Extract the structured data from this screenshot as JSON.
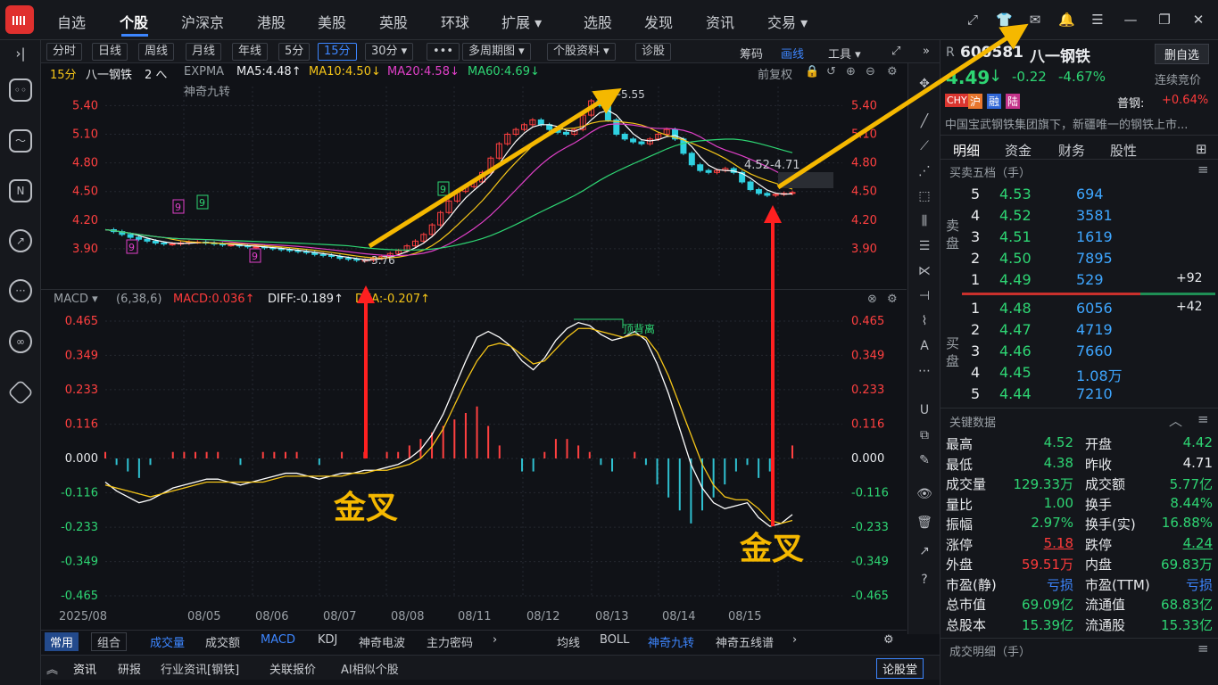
{
  "topnav": {
    "items": [
      "自选",
      "个股",
      "沪深京",
      "港股",
      "美股",
      "英股",
      "环球",
      "扩展 ▾",
      "选股",
      "发现",
      "资讯",
      "交易 ▾"
    ]
  },
  "toolbar": {
    "buttons": [
      "分时",
      "日线",
      "周线",
      "月线",
      "年线",
      "5分",
      "15分",
      "30分 ▾",
      "•••",
      "多周期图 ▾",
      "个股资料 ▾",
      "诊股"
    ],
    "right": [
      "筹码",
      "画线",
      "工具 ▾"
    ]
  },
  "chart_header": {
    "period": "15分",
    "name": "八一钢铁",
    "count": "2 へ",
    "expma": "EXPMA",
    "ma5": "MA5:4.48↑",
    "ma10": "MA10:4.50↓",
    "ma20": "MA20:4.58↓",
    "ma60": "MA60:4.69↓",
    "indicator": "神奇九转",
    "adjust": "前复权"
  },
  "chart_data": [
    {
      "type": "candlestick",
      "title": "15分 八一钢铁",
      "y_ticks": [
        "5.40",
        "5.10",
        "4.80",
        "4.50",
        "4.20",
        "3.90"
      ],
      "ylim": [
        3.6,
        5.6
      ],
      "x_labels": [
        "2025/08",
        "08/05",
        "08/06",
        "08/07",
        "08/08",
        "08/11",
        "08/12",
        "08/13",
        "08/14",
        "08/15"
      ],
      "ma_lines": {
        "MA5": 4.48,
        "MA10": 4.5,
        "MA20": 4.58,
        "MA60": 4.69
      },
      "annotations": [
        "5.55",
        "3.76",
        "4.52-4.71"
      ],
      "close": [
        4.1,
        4.08,
        4.05,
        4.02,
        4.0,
        3.98,
        3.96,
        3.95,
        3.95,
        3.96,
        3.97,
        3.97,
        3.96,
        3.95,
        3.94,
        3.94,
        3.93,
        3.92,
        3.92,
        3.91,
        3.9,
        3.89,
        3.88,
        3.87,
        3.86,
        3.84,
        3.83,
        3.82,
        3.8,
        3.79,
        3.78,
        3.78,
        3.8,
        3.82,
        3.85,
        3.88,
        3.93,
        3.98,
        4.05,
        4.15,
        4.28,
        4.4,
        4.5,
        4.55,
        4.6,
        4.7,
        4.85,
        5.0,
        5.1,
        5.15,
        5.2,
        5.25,
        5.2,
        5.15,
        5.12,
        5.1,
        5.15,
        5.3,
        5.45,
        5.4,
        5.25,
        5.1,
        5.05,
        5.02,
        5.0,
        5.05,
        5.1,
        5.15,
        5.05,
        4.9,
        4.78,
        4.72,
        4.7,
        4.72,
        4.74,
        4.7,
        4.6,
        4.52,
        4.48,
        4.46,
        4.47,
        4.48,
        4.49
      ]
    },
    {
      "type": "line",
      "title": "MACD (6,38,6)",
      "y_ticks": [
        "0.465",
        "0.349",
        "0.233",
        "0.116",
        "0.000",
        "-0.116",
        "-0.233",
        "-0.349",
        "-0.465"
      ],
      "ylim": [
        -0.465,
        0.465
      ],
      "series": [
        {
          "name": "DIFF",
          "value": -0.189
        },
        {
          "name": "DEA",
          "value": -0.207
        },
        {
          "name": "MACD",
          "value": 0.036
        }
      ],
      "diff": [
        -0.08,
        -0.11,
        -0.13,
        -0.15,
        -0.14,
        -0.12,
        -0.1,
        -0.09,
        -0.08,
        -0.07,
        -0.07,
        -0.08,
        -0.09,
        -0.08,
        -0.07,
        -0.06,
        -0.05,
        -0.05,
        -0.06,
        -0.07,
        -0.06,
        -0.05,
        -0.05,
        -0.04,
        -0.04,
        -0.03,
        -0.02,
        0.0,
        0.03,
        0.08,
        0.15,
        0.24,
        0.33,
        0.41,
        0.43,
        0.41,
        0.38,
        0.33,
        0.3,
        0.34,
        0.4,
        0.44,
        0.46,
        0.45,
        0.42,
        0.4,
        0.41,
        0.43,
        0.4,
        0.32,
        0.22,
        0.1,
        -0.02,
        -0.1,
        -0.15,
        -0.17,
        -0.16,
        -0.15,
        -0.2,
        -0.23,
        -0.22,
        -0.19
      ],
      "dea": [
        -0.09,
        -0.1,
        -0.11,
        -0.12,
        -0.13,
        -0.12,
        -0.11,
        -0.1,
        -0.09,
        -0.08,
        -0.08,
        -0.08,
        -0.08,
        -0.08,
        -0.08,
        -0.07,
        -0.06,
        -0.06,
        -0.06,
        -0.06,
        -0.06,
        -0.06,
        -0.05,
        -0.05,
        -0.04,
        -0.04,
        -0.03,
        -0.02,
        0.0,
        0.04,
        0.1,
        0.18,
        0.26,
        0.33,
        0.38,
        0.39,
        0.38,
        0.35,
        0.32,
        0.33,
        0.37,
        0.41,
        0.44,
        0.44,
        0.43,
        0.42,
        0.41,
        0.42,
        0.41,
        0.36,
        0.28,
        0.18,
        0.08,
        -0.02,
        -0.09,
        -0.13,
        -0.14,
        -0.14,
        -0.17,
        -0.21,
        -0.22,
        -0.21
      ],
      "annotations": [
        "顶背离",
        "金叉",
        "金叉"
      ]
    }
  ],
  "macd_header": {
    "name": "MACD ▾",
    "params": "(6,38,6)",
    "macd": "MACD:0.036↑",
    "diff": "DIFF:-0.189↑",
    "dea": "DEA:-0.207↑"
  },
  "bottombar": {
    "tabs": [
      "常用",
      "组合"
    ],
    "indicators": [
      "成交量",
      "成交额",
      "MACD",
      "KDJ",
      "神奇电波",
      "主力密码"
    ],
    "overlays": [
      "均线",
      "BOLL",
      "神奇九转",
      "神奇五线谱"
    ]
  },
  "newsbar": {
    "tabs": [
      "资讯",
      "研报",
      "行业资讯[钢铁]",
      "关联报价",
      "AI相似个股"
    ],
    "button": "论股堂"
  },
  "stock": {
    "prefix": "R",
    "code": "600581",
    "name": "八一钢铁",
    "price": "4.49",
    "arrow": "↓",
    "change": "-0.22",
    "pct": "-4.67%",
    "status": "连续竞价",
    "watch_button": "删自选",
    "tags": [
      "CHY",
      "沪",
      "融",
      "陆"
    ],
    "sector_label": "普钢:",
    "sector_pct": "+0.64%",
    "desc": "中国宝武钢铁集团旗下，新疆唯一的钢铁上市..."
  },
  "rtabs": [
    "明细",
    "资金",
    "财务",
    "股性"
  ],
  "orderbook": {
    "title": "买卖五档（手）",
    "sell_label": "卖盘",
    "buy_label": "买盘",
    "sell": [
      {
        "lvl": "5",
        "price": "4.53",
        "vol": "694",
        "chg": ""
      },
      {
        "lvl": "4",
        "price": "4.52",
        "vol": "3581",
        "chg": ""
      },
      {
        "lvl": "3",
        "price": "4.51",
        "vol": "1619",
        "chg": ""
      },
      {
        "lvl": "2",
        "price": "4.50",
        "vol": "7895",
        "chg": ""
      },
      {
        "lvl": "1",
        "price": "4.49",
        "vol": "529",
        "chg": "+92"
      }
    ],
    "buy": [
      {
        "lvl": "1",
        "price": "4.48",
        "vol": "6056",
        "chg": "+42"
      },
      {
        "lvl": "2",
        "price": "4.47",
        "vol": "4719",
        "chg": ""
      },
      {
        "lvl": "3",
        "price": "4.46",
        "vol": "7660",
        "chg": ""
      },
      {
        "lvl": "4",
        "price": "4.45",
        "vol": "1.08万",
        "chg": ""
      },
      {
        "lvl": "5",
        "price": "4.44",
        "vol": "7210",
        "chg": ""
      }
    ]
  },
  "keydata": {
    "title": "关键数据",
    "rows": [
      [
        "最高",
        "4.52",
        "开盘",
        "4.42"
      ],
      [
        "最低",
        "4.38",
        "昨收",
        "4.71"
      ],
      [
        "成交量",
        "129.33万",
        "成交额",
        "5.77亿"
      ],
      [
        "量比",
        "1.00",
        "换手",
        "8.44%"
      ],
      [
        "振幅",
        "2.97%",
        "换手(实)",
        "16.88%"
      ],
      [
        "涨停",
        "5.18",
        "跌停",
        "4.24"
      ],
      [
        "外盘",
        "59.51万",
        "内盘",
        "69.83万"
      ],
      [
        "市盈(静)",
        "亏损",
        "市盈(TTM)",
        "亏损"
      ],
      [
        "总市值",
        "69.09亿",
        "流通值",
        "68.83亿"
      ],
      [
        "总股本",
        "15.39亿",
        "流通股",
        "15.33亿"
      ]
    ]
  },
  "trades_title": "成交明细（手）"
}
